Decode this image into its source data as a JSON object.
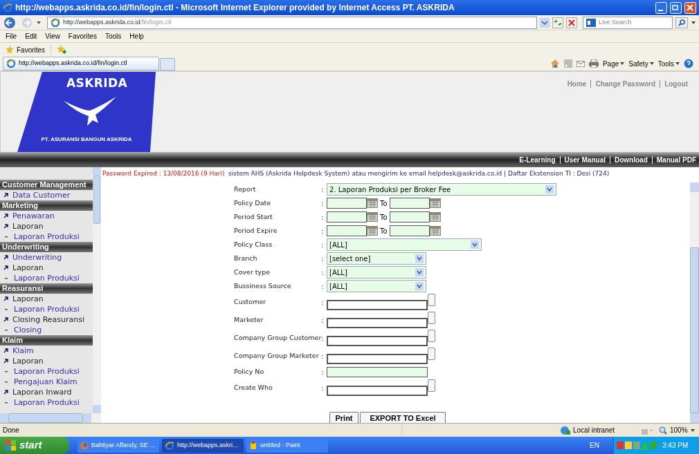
{
  "window": {
    "title": "http://webapps.askrida.co.id/fin/login.ctl - Microsoft Internet Explorer provided by Internet Access PT. ASKRIDA"
  },
  "address_bar": {
    "url_host": "http://webapps.askrida.co.id",
    "url_path": "/fin/login.ctl",
    "search_placeholder": "Live Search"
  },
  "menu": [
    "File",
    "Edit",
    "View",
    "Favorites",
    "Tools",
    "Help"
  ],
  "favorites_bar": {
    "label": "Favorites"
  },
  "tab": {
    "label": "http://webapps.askrida.co.id/fin/login.ctl"
  },
  "command_bar": [
    "Page",
    "Safety",
    "Tools"
  ],
  "header": {
    "logo_title": "ASKRIDA",
    "logo_subtitle": "PT. ASURANSI BANGUN ASKRIDA",
    "links": [
      "Home",
      "Change Password",
      "Logout"
    ]
  },
  "nav_links": [
    "E-Learning",
    "User Manual",
    "Download",
    "Manual PDF"
  ],
  "sidebar": [
    {
      "title": "Customer Management",
      "items": [
        {
          "label": "Data Customer",
          "kind": "link"
        }
      ]
    },
    {
      "title": "Marketing",
      "items": [
        {
          "label": "Penawaran",
          "kind": "link"
        },
        {
          "label": "Laporan",
          "kind": "folder"
        },
        {
          "label": "Laporan Produksi",
          "kind": "sub"
        }
      ]
    },
    {
      "title": "Underwriting",
      "items": [
        {
          "label": "Underwriting",
          "kind": "link"
        },
        {
          "label": "Laporan",
          "kind": "folder"
        },
        {
          "label": "Laporan Produksi",
          "kind": "sub"
        }
      ]
    },
    {
      "title": "Reasuransi",
      "items": [
        {
          "label": "Laporan",
          "kind": "folder"
        },
        {
          "label": "Laporan Produksi",
          "kind": "sub"
        },
        {
          "label": "Closing Reasuransi",
          "kind": "folder"
        },
        {
          "label": "Closing",
          "kind": "sub"
        }
      ]
    },
    {
      "title": "Klaim",
      "items": [
        {
          "label": "Klaim",
          "kind": "link"
        },
        {
          "label": "Laporan",
          "kind": "folder"
        },
        {
          "label": "Laporan Produksi",
          "kind": "sub"
        },
        {
          "label": "Pengajuan Klaim",
          "kind": "sub"
        },
        {
          "label": "Laporan Inward",
          "kind": "folder"
        },
        {
          "label": "Laporan Produksi",
          "kind": "sub"
        }
      ]
    }
  ],
  "password_notice": "Password Expired : 13/08/2016 (9 Hari)",
  "help_text": "sistem AHS (Askrida Helpdesk System) atau mengirim ke email helpdesk@askrida.co.id | Daftar Ekstension TI : Desi (724)",
  "form": [
    {
      "label": "Report",
      "colon": ":",
      "kind": "wide_select",
      "value": "2. Laporan Produksi per Broker Fee"
    },
    {
      "label": "Policy Date",
      "colon": ":",
      "kind": "date_range",
      "to": "To"
    },
    {
      "label": "Period Start",
      "colon": ":",
      "kind": "date_range",
      "to": "To"
    },
    {
      "label": "Period Expire",
      "colon": ":",
      "kind": "date_range",
      "to": "To"
    },
    {
      "label": "Policy Class",
      "colon": ":",
      "kind": "medium_select",
      "value": "[ALL]"
    },
    {
      "label": "Branch",
      "colon": ":",
      "kind": "select",
      "value": "[select one]"
    },
    {
      "label": "Cover type",
      "colon": ":",
      "kind": "select",
      "value": "[ALL]"
    },
    {
      "label": "Bussiness Source",
      "colon": ":",
      "kind": "select",
      "value": "[ALL]"
    },
    {
      "label": "Customer",
      "colon": ":",
      "kind": "lookup"
    },
    {
      "label": "Marketer",
      "colon": ":",
      "kind": "lookup"
    },
    {
      "label": "Company Group Customer",
      "colon": ":",
      "kind": "lookup"
    },
    {
      "label": "Company Group Marketer",
      "colon": ":",
      "kind": "lookup"
    },
    {
      "label": "Policy No",
      "colon": ":",
      "kind": "text"
    },
    {
      "label": "Create Who",
      "colon": ":",
      "kind": "lookup"
    }
  ],
  "buttons": [
    "Print",
    "EXPORT TO Excel"
  ],
  "status_bar": {
    "text": "Done",
    "zone": "Local intranet",
    "zoom": "100%"
  },
  "taskbar": {
    "start": "start",
    "tasks": [
      {
        "label": "Bahtiyar Affandy, SE ...",
        "kind": "firefox",
        "selected": false
      },
      {
        "label": "http://webapps.askri...",
        "kind": "ie",
        "selected": true
      },
      {
        "label": "untitled - Paint",
        "kind": "paint",
        "selected": false
      }
    ],
    "language": "EN",
    "clock": "3:43 PM"
  }
}
